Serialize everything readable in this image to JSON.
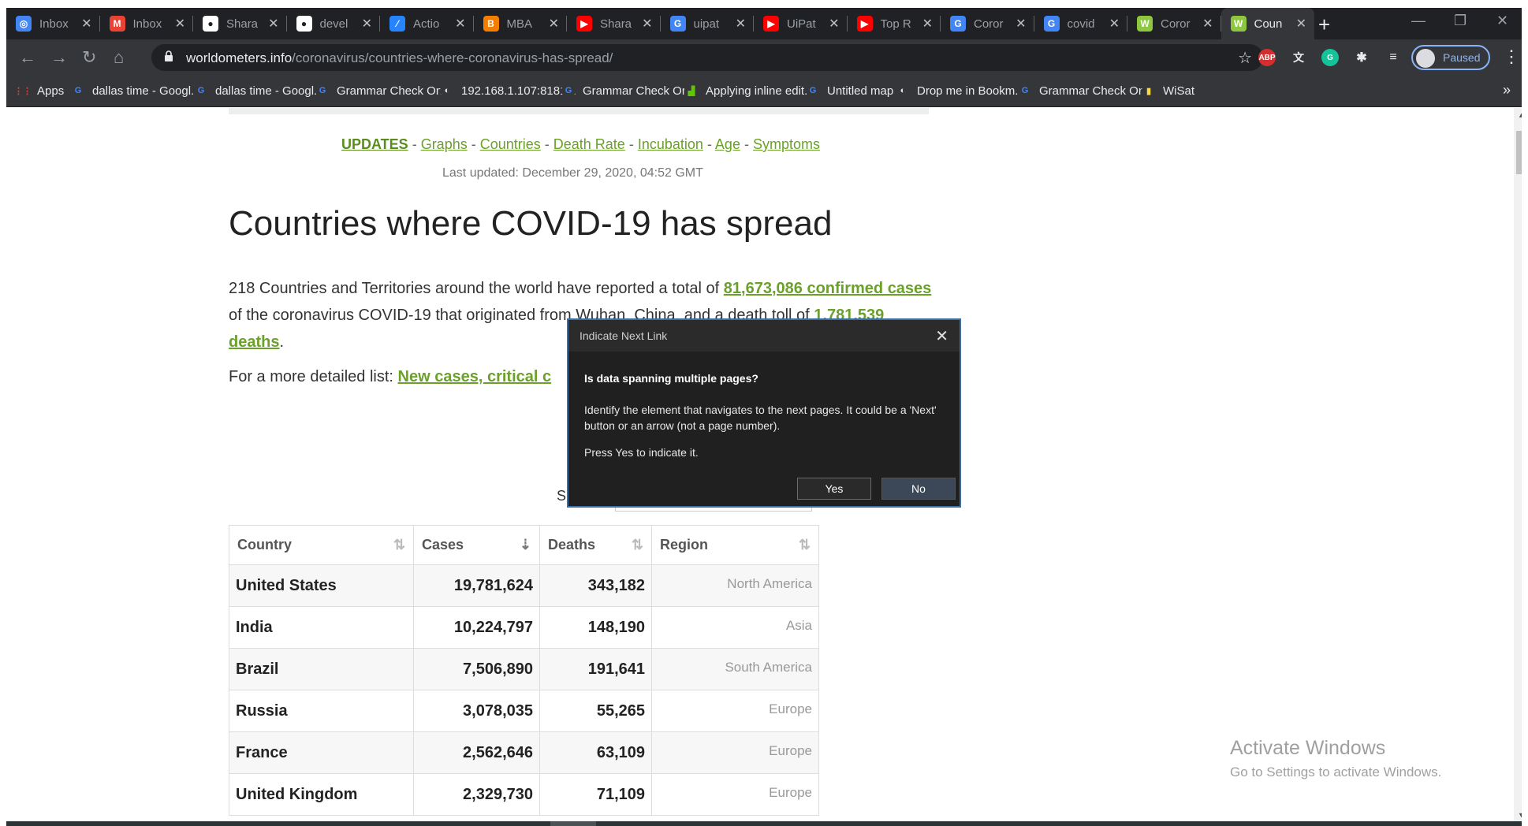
{
  "browser": {
    "tabs": [
      {
        "label": "Inbox",
        "icon": "inbox-app-icon",
        "color": "#4285f4",
        "glyph": "◎"
      },
      {
        "label": "Inbox",
        "icon": "gmail-icon",
        "color": "#ea4335",
        "glyph": "M"
      },
      {
        "label": "Shara",
        "icon": "github-icon",
        "color": "#ffffff",
        "glyph": "●"
      },
      {
        "label": "devel",
        "icon": "github-icon",
        "color": "#ffffff",
        "glyph": "●"
      },
      {
        "label": "Actio",
        "icon": "actions-icon",
        "color": "#2684ff",
        "glyph": "⁄"
      },
      {
        "label": "MBA",
        "icon": "blogger-icon",
        "color": "#f57d00",
        "glyph": "B"
      },
      {
        "label": "Shara",
        "icon": "youtube-icon",
        "color": "#ff0000",
        "glyph": "▶"
      },
      {
        "label": "uipat",
        "icon": "google-icon",
        "color": "#4285f4",
        "glyph": "G"
      },
      {
        "label": "UiPat",
        "icon": "youtube-icon",
        "color": "#ff0000",
        "glyph": "▶"
      },
      {
        "label": "Top R",
        "icon": "youtube-icon",
        "color": "#ff0000",
        "glyph": "▶"
      },
      {
        "label": "Coror",
        "icon": "google-sheets-icon",
        "color": "#4285f4",
        "glyph": "G"
      },
      {
        "label": "covid",
        "icon": "google-icon",
        "color": "#4285f4",
        "glyph": "G"
      },
      {
        "label": "Coror",
        "icon": "worldometers-icon",
        "color": "#8dc63f",
        "glyph": "W"
      },
      {
        "label": "Coun",
        "icon": "worldometers-icon",
        "color": "#8dc63f",
        "glyph": "W",
        "active": true
      }
    ],
    "url_host": "worldometers.info",
    "url_path": "/coronavirus/countries-where-coronavirus-has-spread/",
    "profile_label": "Paused",
    "bookmarks": [
      {
        "label": "Apps",
        "icon": "apps-grid-icon",
        "color": "#ea4335",
        "glyph": "⋮⋮"
      },
      {
        "label": "dallas time - Googl...",
        "icon": "google-icon",
        "color": "#4285f4",
        "glyph": "G"
      },
      {
        "label": "dallas time - Googl...",
        "icon": "google-icon",
        "color": "#4285f4",
        "glyph": "G"
      },
      {
        "label": "Grammar Check On...",
        "icon": "grammar-icon",
        "color": "#4285f4",
        "glyph": "G"
      },
      {
        "label": "192.168.1.107:8181...",
        "icon": "globe-icon",
        "color": "#e8eaed",
        "glyph": "◐"
      },
      {
        "label": "Grammar Check On...",
        "icon": "grammar-icon",
        "color": "#4285f4",
        "glyph": "G"
      },
      {
        "label": "Applying inline edit...",
        "icon": "chart-icon",
        "color": "#5ec700",
        "glyph": "▟"
      },
      {
        "label": "Untitled map",
        "icon": "google-icon",
        "color": "#4285f4",
        "glyph": "G"
      },
      {
        "label": "Drop me in Bookm...",
        "icon": "globe-icon",
        "color": "#e8eaed",
        "glyph": "◐"
      },
      {
        "label": "Grammar Check On...",
        "icon": "grammar-icon",
        "color": "#4285f4",
        "glyph": "G"
      },
      {
        "label": "WiSat",
        "icon": "bookmark-folder-icon",
        "color": "#f9d84a",
        "glyph": "▮"
      }
    ]
  },
  "page": {
    "nav": {
      "updates": "UPDATES",
      "graphs": "Graphs",
      "countries": "Countries",
      "death_rate": "Death Rate",
      "incubation": "Incubation",
      "age": "Age",
      "symptoms": "Symptoms",
      "sep": " - "
    },
    "last_updated": "Last updated: December 29, 2020, 04:52 GMT",
    "title": "Countries where COVID-19 has spread",
    "para": {
      "p1": "218 Countries and Territories around the world have reported a total of ",
      "cases_link": "81,673,086 confirmed cases",
      "p2": " of the coronavirus COVID-19 that originated from Wuhan, China, and a death toll of ",
      "deaths_link": "1,781,539 deaths",
      "p3": "."
    },
    "detailed": {
      "prefix": "For a more detailed list: ",
      "link": "New cases, critical c"
    },
    "search_label": "S",
    "table": {
      "headers": [
        "Country",
        "Cases",
        "Deaths",
        "Region"
      ],
      "rows": [
        {
          "country": "United States",
          "cases": "19,781,624",
          "deaths": "343,182",
          "region": "North America"
        },
        {
          "country": "India",
          "cases": "10,224,797",
          "deaths": "148,190",
          "region": "Asia"
        },
        {
          "country": "Brazil",
          "cases": "7,506,890",
          "deaths": "191,641",
          "region": "South America"
        },
        {
          "country": "Russia",
          "cases": "3,078,035",
          "deaths": "55,265",
          "region": "Europe"
        },
        {
          "country": "France",
          "cases": "2,562,646",
          "deaths": "63,109",
          "region": "Europe"
        },
        {
          "country": "United Kingdom",
          "cases": "2,329,730",
          "deaths": "71,109",
          "region": "Europe"
        }
      ]
    }
  },
  "dialog": {
    "title": "Indicate Next Link",
    "question": "Is data spanning multiple pages?",
    "body": "Identify the element that navigates to the next pages. It could be a 'Next' button or an arrow (not a page number).",
    "body2": "Press Yes to indicate it.",
    "yes": "Yes",
    "no": "No"
  },
  "watermark": {
    "line1": "Activate Windows",
    "line2": "Go to Settings to activate Windows."
  }
}
